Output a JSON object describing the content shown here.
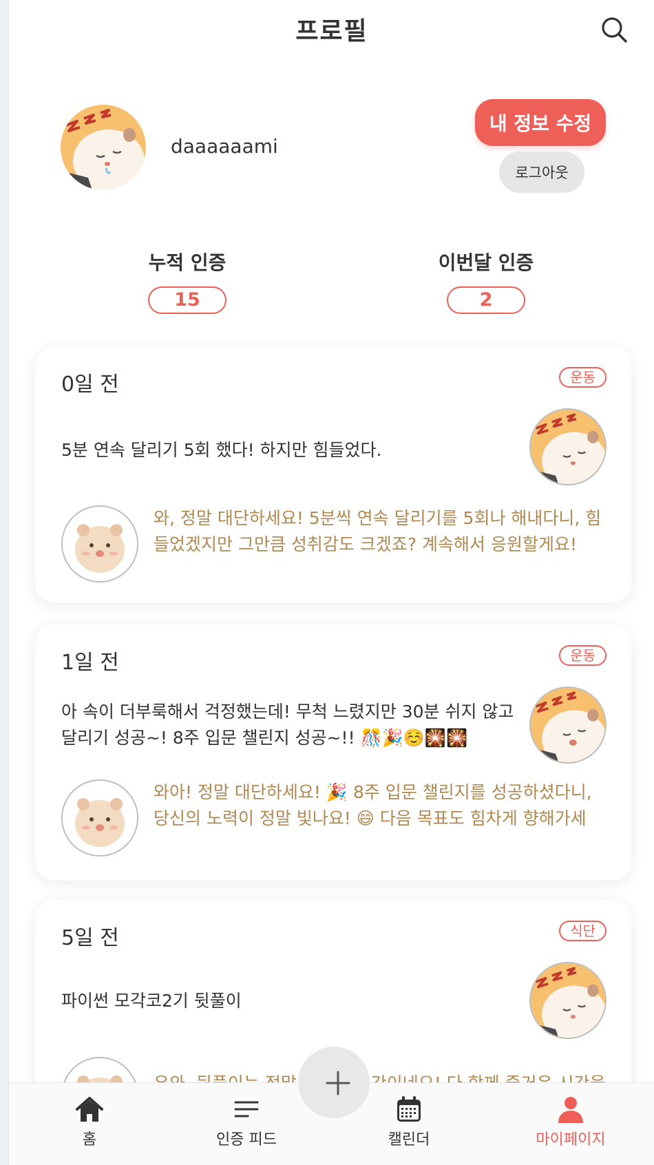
{
  "header": {
    "title": "프로필"
  },
  "profile": {
    "username": "daaaaaami",
    "edit_label": "내 정보 수정",
    "logout_label": "로그아웃"
  },
  "stats": [
    {
      "label": "누적 인증",
      "value": "15"
    },
    {
      "label": "이번달 인증",
      "value": "2"
    }
  ],
  "feed": [
    {
      "date": "0일 전",
      "tag": "운동",
      "text": "5분 연속 달리기 5회 했다! 하지만 힘들었다.",
      "comment": "와, 정말 대단하세요! 5분씩 연속 달리기를 5회나 해내다니, 힘들었겠지만 그만큼 성취감도 크겠죠? 계속해서 응원할게요! 다…"
    },
    {
      "date": "1일 전",
      "tag": "운동",
      "text": "아 속이 더부룩해서 걱정했는데! 무척 느렸지만 30분 쉬지 않고 달리기 성공~! 8주 입문 챌린지 성공~!! 🎊🎉☺️🎇🎇",
      "comment": "와아! 정말 대단하세요! 🎉 8주 입문 챌린지를 성공하셨다니, 당신의 노력이 정말 빛나요! 😄 다음 목표도 힘차게 향해가세요! …"
    },
    {
      "date": "5일 전",
      "tag": "식단",
      "text": "파이썬 모각코2기 뒷풀이",
      "comment": "우와, 뒷풀이는 정말 즐거운 시간이네요! 다 함께 즐거운 시간을 보"
    }
  ],
  "bottom_nav": {
    "items": [
      {
        "label": "홈",
        "icon": "home-icon"
      },
      {
        "label": "인증 피드",
        "icon": "feed-icon"
      },
      {
        "label": "캘린더",
        "icon": "calendar-icon"
      },
      {
        "label": "마이페이지",
        "icon": "person-icon"
      }
    ],
    "active_index": 3,
    "fab_icon": "plus-icon"
  },
  "colors": {
    "accent": "#ee5f57",
    "comment_text": "#b08850",
    "logout_bg": "#e6e6e6"
  }
}
